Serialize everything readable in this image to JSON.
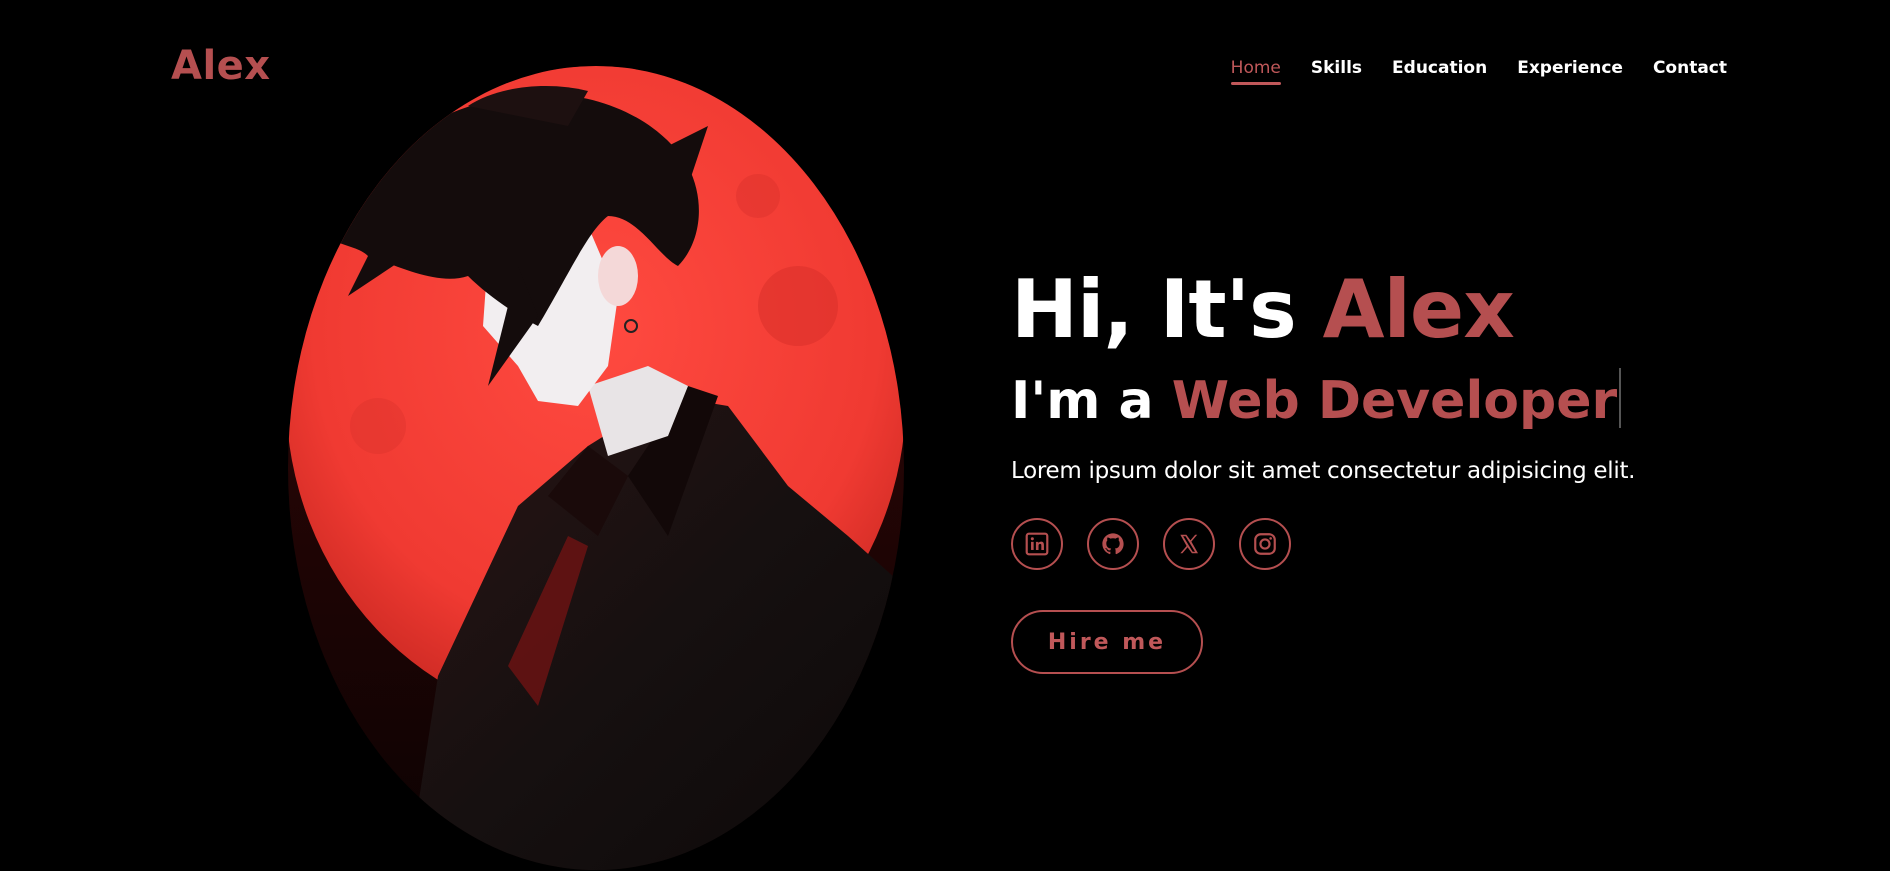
{
  "brand": {
    "logo_text": "Alex"
  },
  "nav": {
    "items": [
      {
        "label": "Home",
        "active": true
      },
      {
        "label": "Skills"
      },
      {
        "label": "Education"
      },
      {
        "label": "Experience"
      },
      {
        "label": "Contact"
      }
    ]
  },
  "hero": {
    "greeting": "Hi, It's ",
    "name": "Alex",
    "role_prefix": "I'm a ",
    "role": "Web Developer",
    "description": "Lorem ipsum dolor sit amet consectetur adipisicing elit.",
    "hire_label": "Hire me"
  },
  "socials": [
    {
      "icon": "linkedin-icon"
    },
    {
      "icon": "github-icon"
    },
    {
      "icon": "x-icon"
    },
    {
      "icon": "instagram-icon"
    }
  ],
  "colors": {
    "background": "#000000",
    "accent": "#b54f50",
    "text": "#ffffff",
    "moon_red": "#f03a32"
  }
}
